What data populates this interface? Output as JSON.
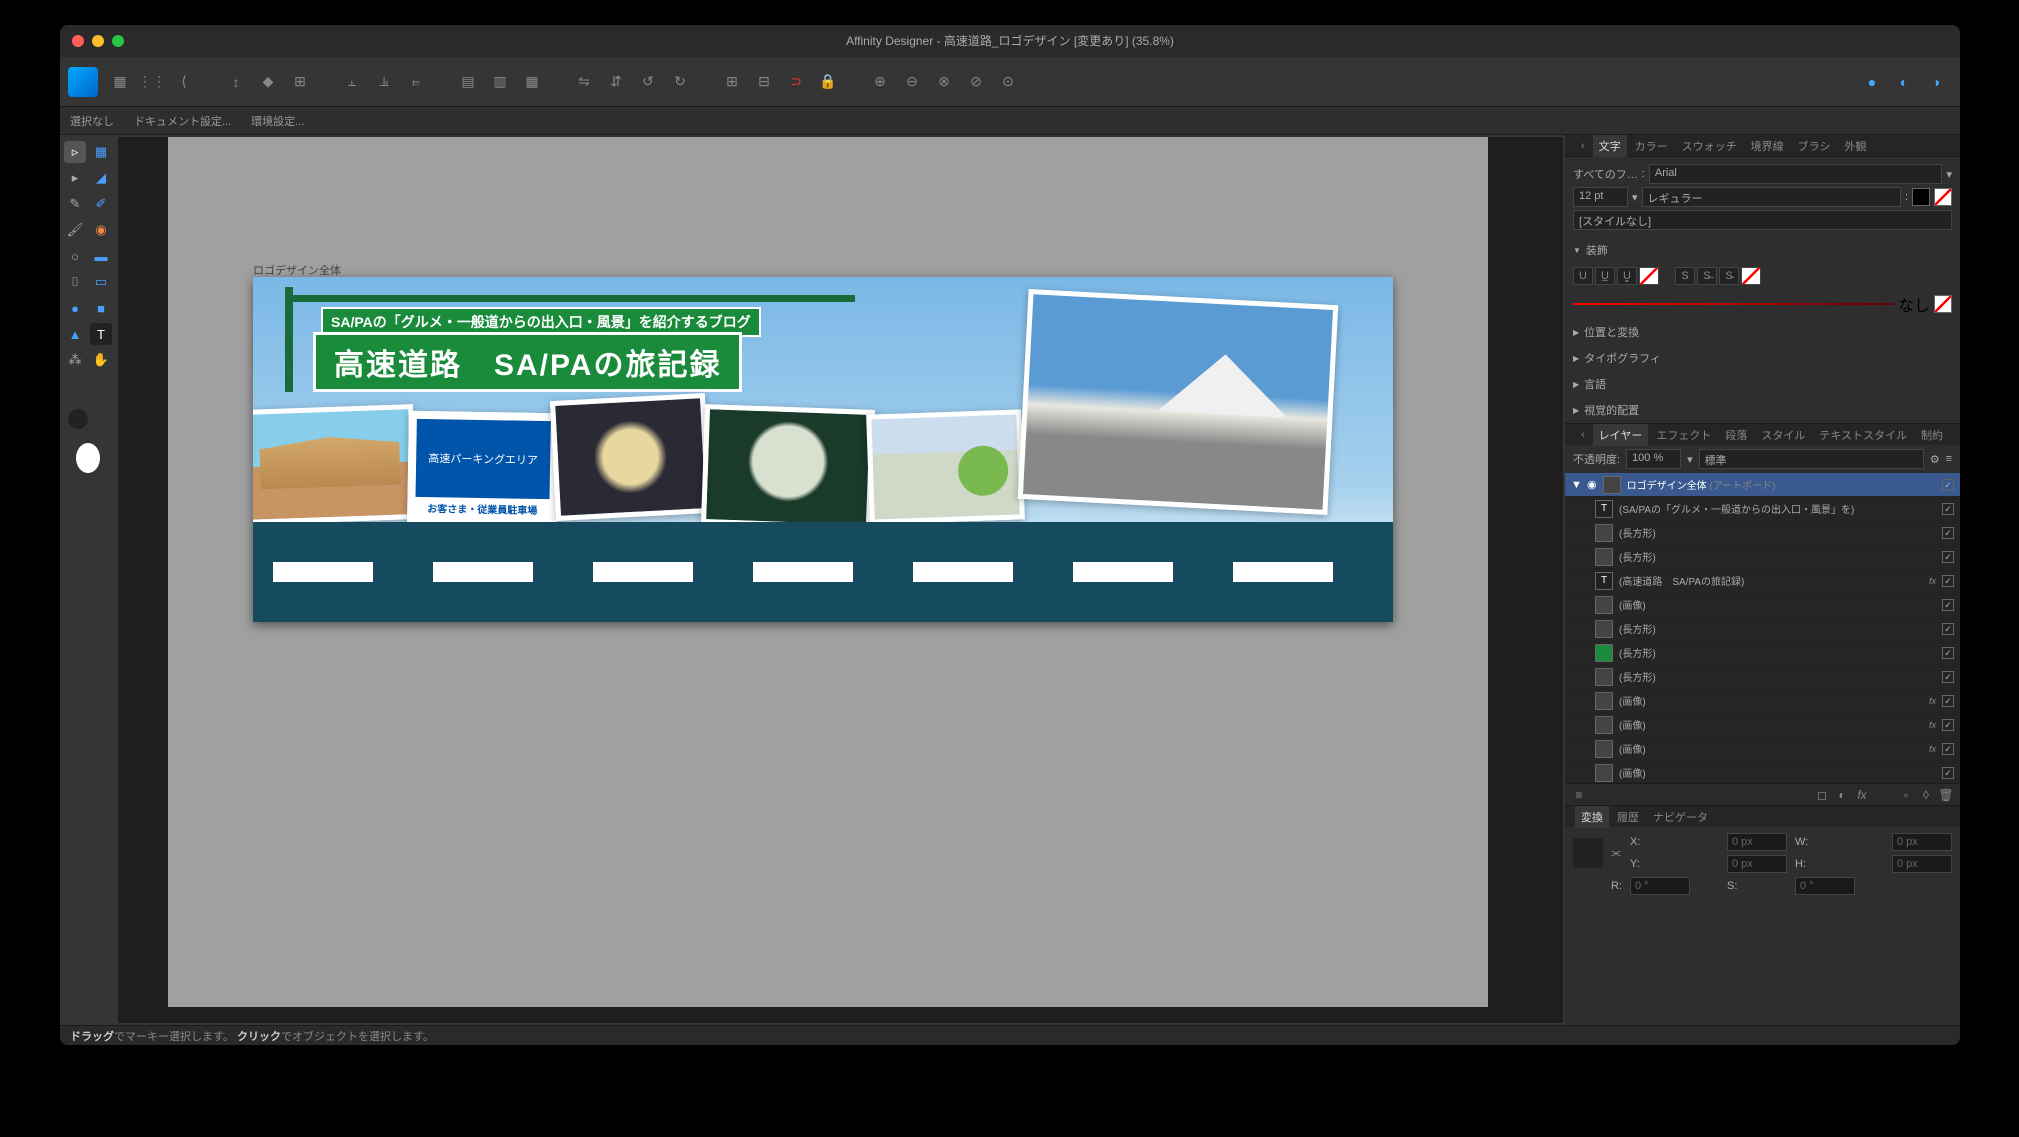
{
  "title": "Affinity Designer - 高速道路_ロゴデザイン [変更あり] (35.8%)",
  "contextBar": {
    "noSelection": "選択なし",
    "docSettings": "ドキュメント設定...",
    "prefs": "環境設定..."
  },
  "artboard": {
    "label": "ロゴデザイン全体",
    "signSub": "SA/PAの「グルメ・一般道からの出入口・風景」を紹介するブログ",
    "signMain": "高速道路　SA/PAの旅記録",
    "parkingTop": "高速パーキングエリア",
    "parkingMain": "お客さま・従業員駐車場"
  },
  "panels": {
    "charTabs": [
      "文字",
      "カラー",
      "スウォッチ",
      "境界線",
      "ブラシ",
      "外観"
    ],
    "fontGroup": "すべてのフ…",
    "font": "Arial",
    "size": "12 pt",
    "weight": "レギュラー",
    "styleNone": "[スタイルなし]",
    "decoration": "装飾",
    "decoNone": "なし",
    "posTransform": "位置と変換",
    "typography": "タイポグラフィ",
    "language": "言語",
    "optical": "視覚的配置",
    "layerTabs": [
      "レイヤー",
      "エフェクト",
      "段落",
      "スタイル",
      "テキストスタイル",
      "制約"
    ],
    "opacityLabel": "不透明度:",
    "opacityVal": "100 %",
    "blendMode": "標準"
  },
  "layers": [
    {
      "name": "ロゴデザイン全体",
      "hint": "(アートボード)",
      "sel": true,
      "fx": false,
      "indent": 0
    },
    {
      "name": "(SA/PAの「グルメ・一般道からの出入口・風景」を)",
      "fx": false,
      "indent": 1,
      "thumb": "text"
    },
    {
      "name": "(長方形)",
      "fx": false,
      "indent": 1
    },
    {
      "name": "(長方形)",
      "fx": false,
      "indent": 1
    },
    {
      "name": "(高速道路　SA/PAの旅記録)",
      "fx": true,
      "indent": 1,
      "thumb": "text"
    },
    {
      "name": "(画像)",
      "fx": false,
      "indent": 1
    },
    {
      "name": "(長方形)",
      "fx": false,
      "indent": 1
    },
    {
      "name": "(長方形)",
      "fx": false,
      "indent": 1,
      "thumb": "green"
    },
    {
      "name": "(長方形)",
      "fx": false,
      "indent": 1
    },
    {
      "name": "(画像)",
      "fx": true,
      "indent": 1
    },
    {
      "name": "(画像)",
      "fx": true,
      "indent": 1
    },
    {
      "name": "(画像)",
      "fx": true,
      "indent": 1
    },
    {
      "name": "(画像)",
      "fx": false,
      "indent": 1
    }
  ],
  "transform": {
    "tabs": [
      "変換",
      "履歴",
      "ナビゲータ"
    ],
    "x": "X:",
    "xval": "0 px",
    "y": "Y:",
    "yval": "0 px",
    "w": "W:",
    "wval": "0 px",
    "h": "H:",
    "hval": "0 px",
    "r": "R:",
    "rval": "0 °",
    "s": "S:",
    "sval": "0 °"
  },
  "status": {
    "drag": "ドラッグ",
    "dragTxt": "でマーキー選択します。",
    "click": "クリック",
    "clickTxt": "でオブジェクトを選択します。"
  }
}
